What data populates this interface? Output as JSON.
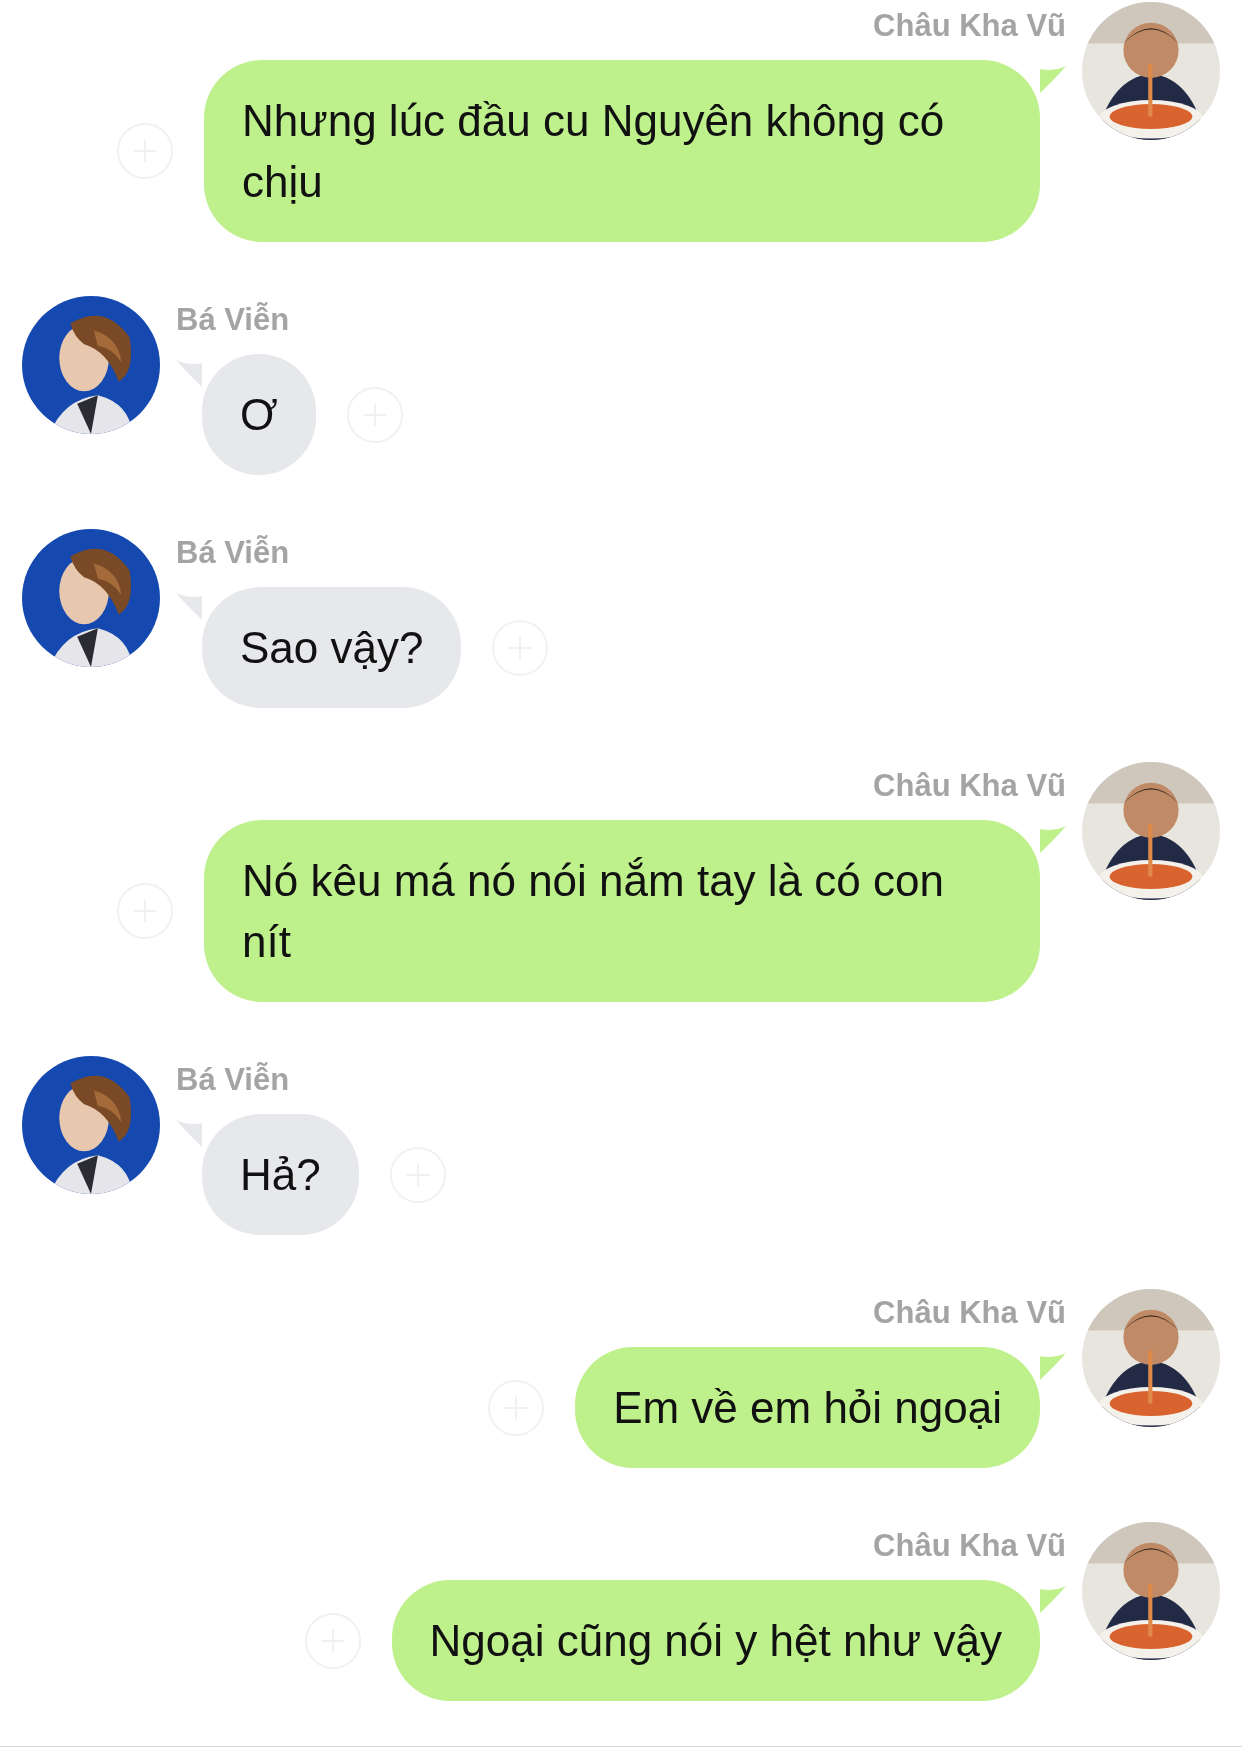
{
  "messages": [
    {
      "kind": "sent",
      "sender": "Châu Kha Vũ",
      "text": "Nhưng lúc đầu cu Nguyên không có chịu"
    },
    {
      "kind": "received",
      "sender": "Bá Viễn",
      "text": "Ơ"
    },
    {
      "kind": "received",
      "sender": "Bá Viễn",
      "text": "Sao vậy?"
    },
    {
      "kind": "sent",
      "sender": "Châu Kha Vũ",
      "text": "Nó kêu má nó nói nắm tay là có con nít"
    },
    {
      "kind": "received",
      "sender": "Bá Viễn",
      "text": "Hả?"
    },
    {
      "kind": "sent",
      "sender": "Châu Kha Vũ",
      "text": "Em về em hỏi ngoại"
    },
    {
      "kind": "sent",
      "sender": "Châu Kha Vũ",
      "text": "Ngoại cũng nói y hệt như vậy"
    }
  ]
}
